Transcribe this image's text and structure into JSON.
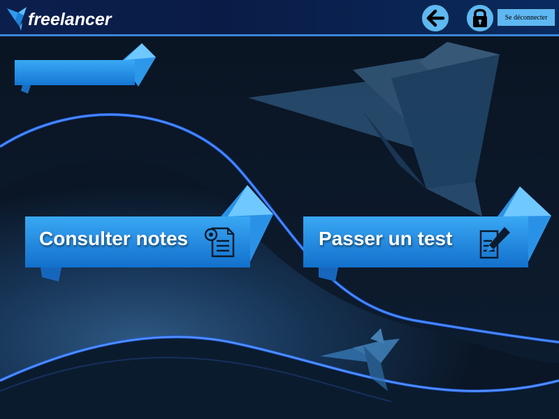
{
  "header": {
    "logo_text": "freelancer",
    "logout_label": "Se déconnecter"
  },
  "actions": [
    {
      "label": "Consulter notes",
      "icon": "notes-document-icon"
    },
    {
      "label": "Passer un test",
      "icon": "test-edit-icon"
    }
  ],
  "colors": {
    "header_bg": "#0b1f4d",
    "accent": "#1f8fe8",
    "button_light": "#5fb8f2",
    "background": "#0a1626"
  }
}
